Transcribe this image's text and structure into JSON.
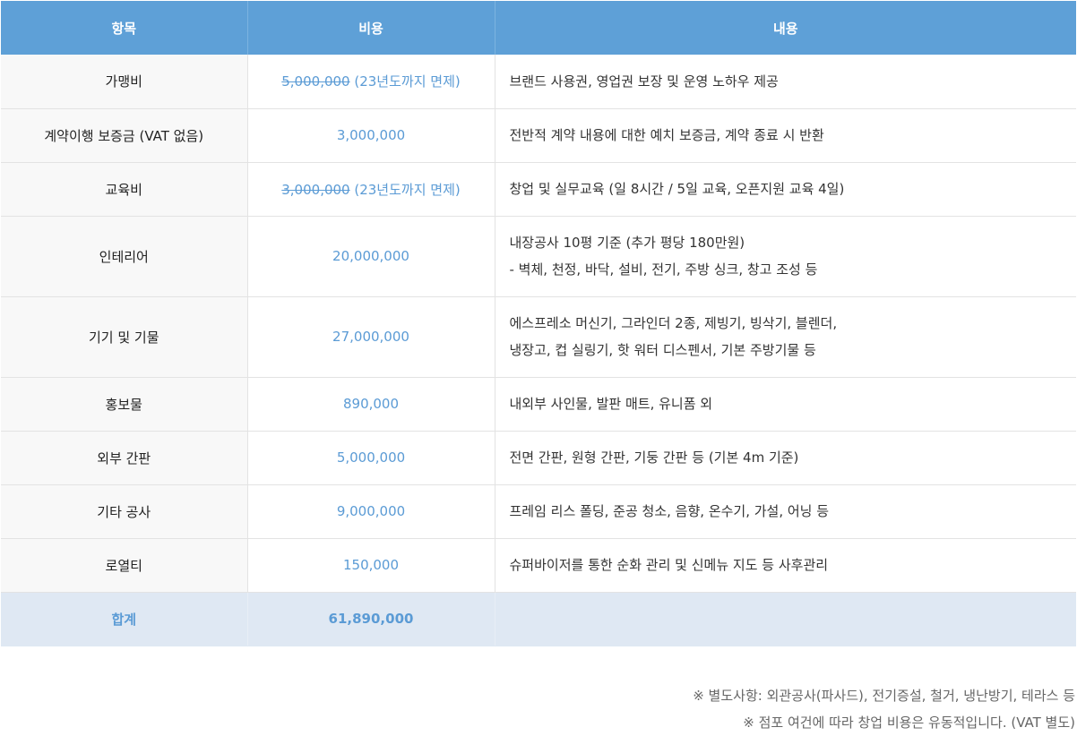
{
  "table": {
    "headers": [
      "항목",
      "비용",
      "내용"
    ],
    "rows": [
      {
        "item": "가맹비",
        "cost_strike": "5,000,000",
        "cost_note": " (23년도까지 면제)",
        "desc": [
          "브랜드 사용권, 영업권 보장 및 운영 노하우 제공"
        ]
      },
      {
        "item": "계약이행 보증금 (VAT 없음)",
        "cost": "3,000,000",
        "desc": [
          "전반적 계약 내용에 대한 예치 보증금, 계약 종료 시 반환"
        ]
      },
      {
        "item": "교육비",
        "cost_strike": "3,000,000",
        "cost_note": " (23년도까지 면제)",
        "desc": [
          "창업 및 실무교육 (일 8시간 / 5일 교육, 오픈지원 교육 4일)"
        ]
      },
      {
        "item": "인테리어",
        "cost": "20,000,000",
        "desc": [
          "내장공사 10평 기준 (추가 평당 180만원)",
          "- 벽체, 천정, 바닥, 설비, 전기, 주방 싱크, 창고 조성 등"
        ]
      },
      {
        "item": "기기 및 기물",
        "cost": "27,000,000",
        "desc": [
          "에스프레소 머신기, 그라인더 2종, 제빙기, 빙삭기, 블렌더,",
          "냉장고, 컵 실링기, 핫 워터 디스펜서, 기본 주방기물 등"
        ]
      },
      {
        "item": "홍보물",
        "cost": "890,000",
        "desc": [
          "내외부 사인물, 발판 매트, 유니폼 외"
        ]
      },
      {
        "item": "외부 간판",
        "cost": "5,000,000",
        "desc": [
          "전면 간판, 원형 간판, 기둥 간판 등 (기본 4m 기준)"
        ]
      },
      {
        "item": "기타 공사",
        "cost": "9,000,000",
        "desc": [
          "프레임 리스 폴딩, 준공 청소, 음향, 온수기, 가설, 어닝 등"
        ]
      },
      {
        "item": "로열티",
        "cost": "150,000",
        "desc": [
          "슈퍼바이저를 통한 순화 관리 및 신메뉴 지도 등 사후관리"
        ]
      }
    ],
    "total": {
      "label": "합계",
      "cost": "61,890,000",
      "desc": ""
    }
  },
  "notes": [
    "※ 별도사항: 외관공사(파사드), 전기증설, 철거, 냉난방기, 테라스 등",
    "※ 점포 여건에 따라 창업 비용은 유동적입니다. (VAT 별도)"
  ],
  "colors": {
    "header_bg": "#5ea0d7",
    "accent_text": "#5b9bd5",
    "total_bg": "#dfe8f3",
    "label_bg": "#f8f8f8"
  }
}
